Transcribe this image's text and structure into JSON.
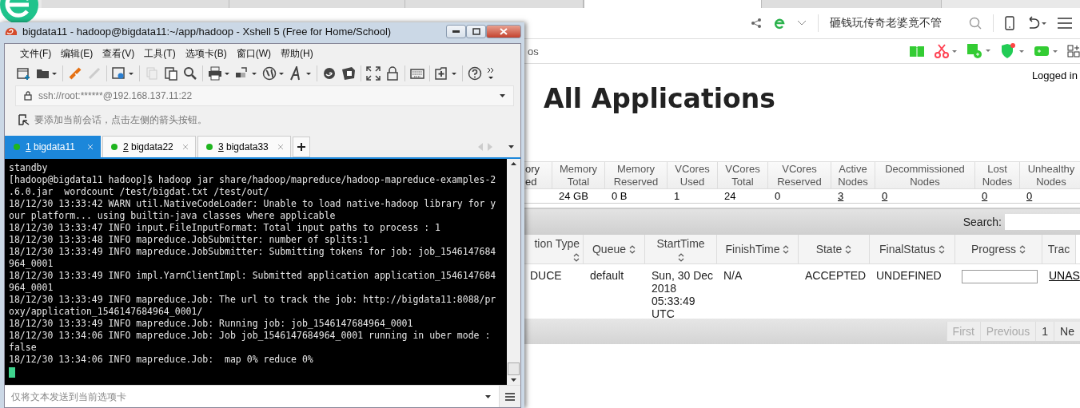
{
  "browser": {
    "tabs": [
      {
        "selected": false
      },
      {
        "selected": false
      },
      {
        "selected": false
      },
      {
        "selected": true
      },
      {
        "selected": false
      }
    ],
    "search_suggestion": "砸钱玩传奇老婆竟不管",
    "bookmarks_bar": {
      "text": "os"
    },
    "page": {
      "logged_in": "Logged in",
      "heading": "All Applications",
      "metrics": [
        {
          "label": [
            "ory",
            "ed"
          ]
        },
        {
          "label": [
            "Memory",
            "Total"
          ],
          "value": "24 GB",
          "link": false
        },
        {
          "label": [
            "Memory",
            "Reserved"
          ],
          "value": "0 B",
          "link": false
        },
        {
          "label": [
            "VCores",
            "Used"
          ],
          "value": "1",
          "link": false
        },
        {
          "label": [
            "VCores",
            "Total"
          ],
          "value": "24",
          "link": false
        },
        {
          "label": [
            "VCores",
            "Reserved"
          ],
          "value": "0",
          "link": false
        },
        {
          "label": [
            "Active",
            "Nodes"
          ],
          "value": "3",
          "link": true
        },
        {
          "label": [
            "Decommissioned",
            "Nodes"
          ],
          "value": "0",
          "link": true
        },
        {
          "label": [
            "Lost",
            "Nodes"
          ],
          "value": "0",
          "link": true
        },
        {
          "label": [
            "Unhealthy",
            "Nodes"
          ],
          "value": "0",
          "link": true
        }
      ],
      "search_label": "Search:",
      "apps": {
        "columns": [
          "tion Type",
          "Queue",
          "StartTime",
          "FinishTime",
          "State",
          "FinalStatus",
          "Progress",
          "Trac"
        ],
        "rows": [
          {
            "type": "DUCE",
            "queue": "default",
            "start": "Sun, 30 Dec 2018 05:33:49 UTC",
            "finish": "N/A",
            "state": "ACCEPTED",
            "final_status": "UNDEFINED",
            "progress": {
              "level": 0
            },
            "tracking": "UNAS"
          }
        ]
      },
      "paging": [
        {
          "label": "First",
          "disabled": true
        },
        {
          "label": "Previous",
          "disabled": true
        },
        {
          "label": "1",
          "disabled": false
        },
        {
          "label": "Ne",
          "disabled": false
        }
      ]
    }
  },
  "xshell": {
    "title": "bigdata11 - hadoop@bigdata11:~/app/hadoop - Xshell 5 (Free for Home/School)",
    "menu": [
      "文件(F)",
      "编辑(E)",
      "查看(V)",
      "工具(T)",
      "选项卡(B)",
      "窗口(W)",
      "帮助(H)"
    ],
    "address": "ssh://root:******@192.168.137.11:22",
    "hint": "要添加当前会话，点击左侧的箭头按钮。",
    "tabs": [
      {
        "number": "1",
        "name": "bigdata11",
        "selected": true
      },
      {
        "number": "2",
        "name": "bigdata22",
        "selected": false
      },
      {
        "number": "3",
        "name": "bigdata33",
        "selected": false
      }
    ],
    "terminal": {
      "lines": [
        "standby",
        "[hadoop@bigdata11 hadoop]$ hadoop jar share/hadoop/mapreduce/hadoop-mapreduce-examples-2",
        ".6.0.jar  wordcount /test/bigdat.txt /test/out/",
        "18/12/30 13:33:42 WARN util.NativeCodeLoader: Unable to load native-hadoop library for y",
        "our platform... using builtin-java classes where applicable",
        "18/12/30 13:33:47 INFO input.FileInputFormat: Total input paths to process : 1",
        "18/12/30 13:33:48 INFO mapreduce.JobSubmitter: number of splits:1",
        "18/12/30 13:33:49 INFO mapreduce.JobSubmitter: Submitting tokens for job: job_1546147684",
        "964_0001",
        "18/12/30 13:33:49 INFO impl.YarnClientImpl: Submitted application application_1546147684",
        "964_0001",
        "18/12/30 13:33:49 INFO mapreduce.Job: The url to track the job: http://bigdata11:8088/pr",
        "oxy/application_1546147684964_0001/",
        "18/12/30 13:33:49 INFO mapreduce.Job: Running job: job_1546147684964_0001",
        "18/12/30 13:34:06 INFO mapreduce.Job: Job job_1546147684964_0001 running in uber mode :",
        "false",
        "18/12/30 13:34:06 INFO mapreduce.Job:  map 0% reduce 0%"
      ]
    },
    "send_bar": {
      "placeholder": "仅将文本发送到当前选项卡"
    }
  }
}
